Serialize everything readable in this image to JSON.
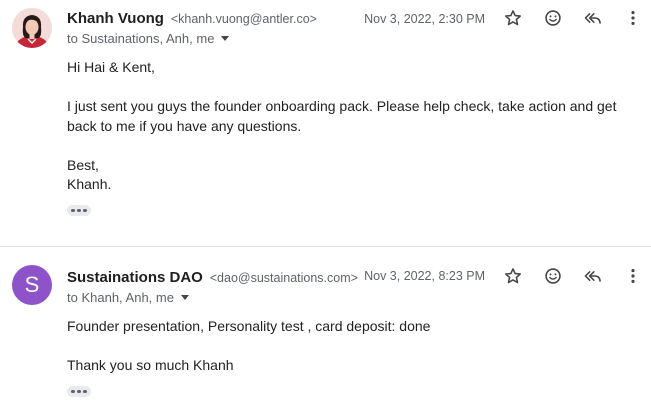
{
  "messages": [
    {
      "sender_name": "Khanh Vuong",
      "sender_email": "<khanh.vuong@antler.co>",
      "recipients": "to Sustainations, Anh, me",
      "date": "Nov 3, 2022, 2:30 PM",
      "avatar": "profile-photo",
      "body": [
        "Hi Hai & Kent,",
        "",
        "I just sent you guys the founder onboarding pack. Please help check, take action and get back to me if you have any questions.",
        "",
        "Best,",
        "Khanh."
      ]
    },
    {
      "sender_name": "Sustainations DAO",
      "sender_email": "<dao@sustainations.com>",
      "recipients": "to Khanh, Anh, me",
      "date": "Nov 3, 2022, 8:23 PM",
      "avatar": "S",
      "avatar_color": "#8e52c9",
      "body": [
        "Founder presentation, Personality test , card deposit: done",
        "",
        "Thank you so much Khanh"
      ]
    }
  ],
  "icons": {
    "star": "star-icon",
    "emoji": "add-reaction-icon",
    "reply_all": "reply-all-icon",
    "more": "more-vert-icon",
    "expand": "show-trimmed-content-icon",
    "recipients_caret": "chevron-down-icon"
  },
  "colors": {
    "text": "#202124",
    "muted": "#5f6368",
    "avatar_purple": "#8e52c9",
    "divider": "#e4e4e4"
  }
}
